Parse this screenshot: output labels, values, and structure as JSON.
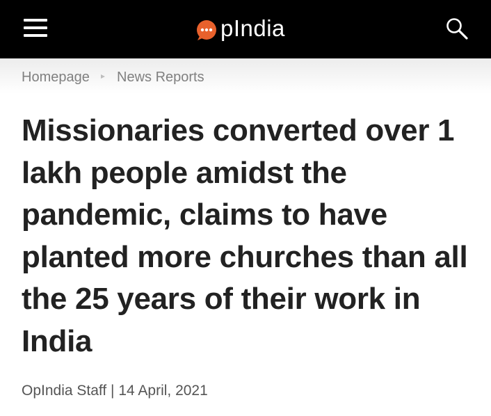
{
  "header": {
    "menu_icon": "hamburger-menu-icon",
    "logo_text": "pIndia",
    "logo_mark_color": "#e8612c",
    "search_icon": "search-icon",
    "background_color": "#000000"
  },
  "breadcrumb": {
    "home": "Homepage",
    "category": "News Reports"
  },
  "article": {
    "title": "Missionaries converted over 1 lakh people amidst the pandemic, claims to have planted more churches than all the 25 years of their work in India",
    "author": "OpIndia Staff",
    "separator": "|",
    "date": "14 April, 2021"
  }
}
